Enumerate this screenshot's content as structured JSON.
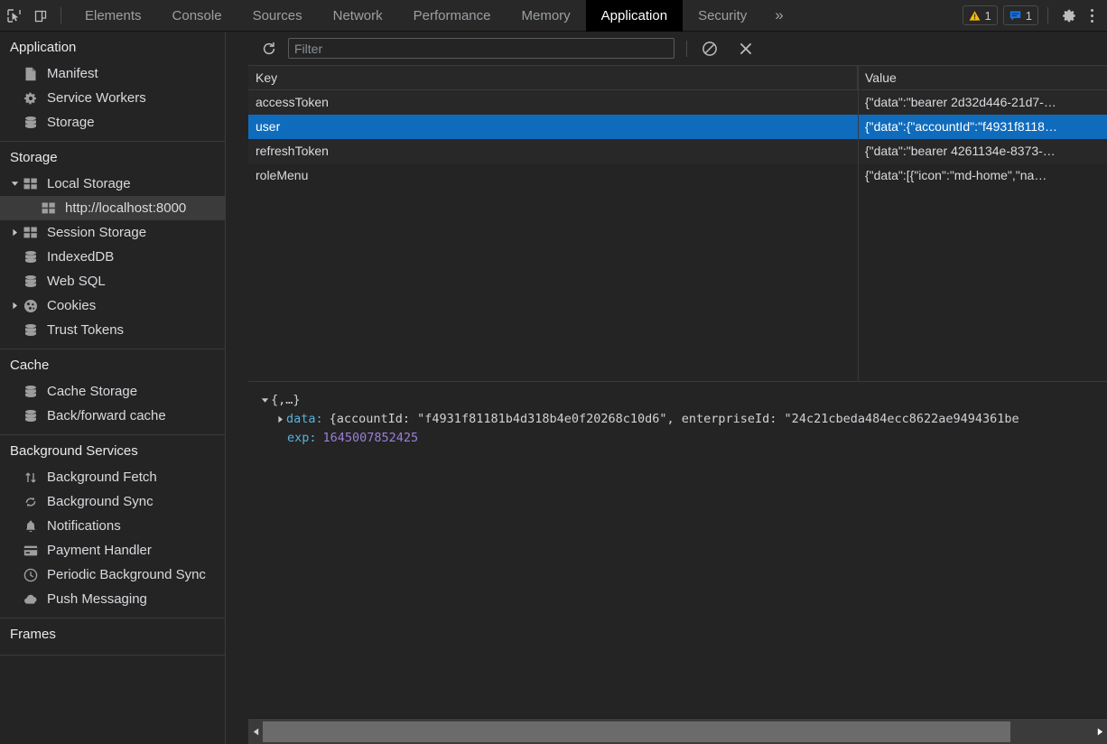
{
  "toolbar": {
    "inspect_icon": "inspect-cursor-icon",
    "device_icon": "device-toolbar-icon",
    "tabs": [
      {
        "label": "Elements",
        "active": false
      },
      {
        "label": "Console",
        "active": false
      },
      {
        "label": "Sources",
        "active": false
      },
      {
        "label": "Network",
        "active": false
      },
      {
        "label": "Performance",
        "active": false
      },
      {
        "label": "Memory",
        "active": false
      },
      {
        "label": "Application",
        "active": true
      },
      {
        "label": "Security",
        "active": false
      }
    ],
    "more_tabs_label": "»",
    "warning_count": "1",
    "message_count": "1",
    "settings_icon": "gear-icon",
    "menu_icon": "kebab-menu-icon",
    "accent_active_bg": "#000000",
    "warning_color": "#fbbc04",
    "message_color": "#1a73e8"
  },
  "sidebar": {
    "groups": [
      {
        "title": "Application",
        "items": [
          {
            "label": "Manifest",
            "icon": "manifest-file-icon",
            "indent": 1,
            "twisty": "none",
            "selected": false
          },
          {
            "label": "Service Workers",
            "icon": "gear-icon",
            "indent": 1,
            "twisty": "none",
            "selected": false
          },
          {
            "label": "Storage",
            "icon": "database-icon",
            "indent": 1,
            "twisty": "none",
            "selected": false
          }
        ]
      },
      {
        "title": "Storage",
        "items": [
          {
            "label": "Local Storage",
            "icon": "table-grid-icon",
            "indent": 1,
            "twisty": "expanded",
            "selected": false
          },
          {
            "label": "http://localhost:8000",
            "icon": "table-grid-icon",
            "indent": 2,
            "twisty": "none",
            "selected": true
          },
          {
            "label": "Session Storage",
            "icon": "table-grid-icon",
            "indent": 1,
            "twisty": "collapsed",
            "selected": false
          },
          {
            "label": "IndexedDB",
            "icon": "database-icon",
            "indent": 1,
            "twisty": "none",
            "selected": false
          },
          {
            "label": "Web SQL",
            "icon": "database-icon",
            "indent": 1,
            "twisty": "none",
            "selected": false
          },
          {
            "label": "Cookies",
            "icon": "cookie-icon",
            "indent": 1,
            "twisty": "collapsed",
            "selected": false
          },
          {
            "label": "Trust Tokens",
            "icon": "database-icon",
            "indent": 1,
            "twisty": "none",
            "selected": false
          }
        ]
      },
      {
        "title": "Cache",
        "items": [
          {
            "label": "Cache Storage",
            "icon": "database-icon",
            "indent": 1,
            "twisty": "none",
            "selected": false
          },
          {
            "label": "Back/forward cache",
            "icon": "database-icon",
            "indent": 1,
            "twisty": "none",
            "selected": false
          }
        ]
      },
      {
        "title": "Background Services",
        "items": [
          {
            "label": "Background Fetch",
            "icon": "arrows-updown-icon",
            "indent": 1,
            "twisty": "none",
            "selected": false
          },
          {
            "label": "Background Sync",
            "icon": "sync-icon",
            "indent": 1,
            "twisty": "none",
            "selected": false
          },
          {
            "label": "Notifications",
            "icon": "bell-icon",
            "indent": 1,
            "twisty": "none",
            "selected": false
          },
          {
            "label": "Payment Handler",
            "icon": "credit-card-icon",
            "indent": 1,
            "twisty": "none",
            "selected": false
          },
          {
            "label": "Periodic Background Sync",
            "icon": "clock-icon",
            "indent": 1,
            "twisty": "none",
            "selected": false
          },
          {
            "label": "Push Messaging",
            "icon": "cloud-icon",
            "indent": 1,
            "twisty": "none",
            "selected": false
          }
        ]
      },
      {
        "title": "Frames",
        "items": []
      }
    ],
    "selected_bg": "#3b3b3b"
  },
  "panel": {
    "refresh_icon": "refresh-icon",
    "filter": {
      "value": "",
      "placeholder": "Filter"
    },
    "clear_icon": "clear-all-icon",
    "delete_icon": "delete-selected-icon",
    "table": {
      "columns": [
        "Key",
        "Value"
      ],
      "rows": [
        {
          "key": "accessToken",
          "value": "{\"data\":\"bearer 2d32d446-21d7-…",
          "selected": false
        },
        {
          "key": "user",
          "value": "{\"data\":{\"accountId\":\"f4931f8118…",
          "selected": true
        },
        {
          "key": "refreshToken",
          "value": "{\"data\":\"bearer 4261134e-8373-…",
          "selected": false
        },
        {
          "key": "roleMenu",
          "value": "{\"data\":[{\"icon\":\"md-home\",\"na…",
          "selected": false
        }
      ],
      "selected_row_bg": "#0f6cbd"
    },
    "preview": {
      "root_line": "{,…}",
      "data_key": "data:",
      "data_value": "{accountId: \"f4931f81181b4d318b4e0f20268c10d6\", enterpriseId: \"24c21cbeda484ecc8622ae9494361be",
      "exp_key": "exp:",
      "exp_value": "1645007852425"
    }
  }
}
